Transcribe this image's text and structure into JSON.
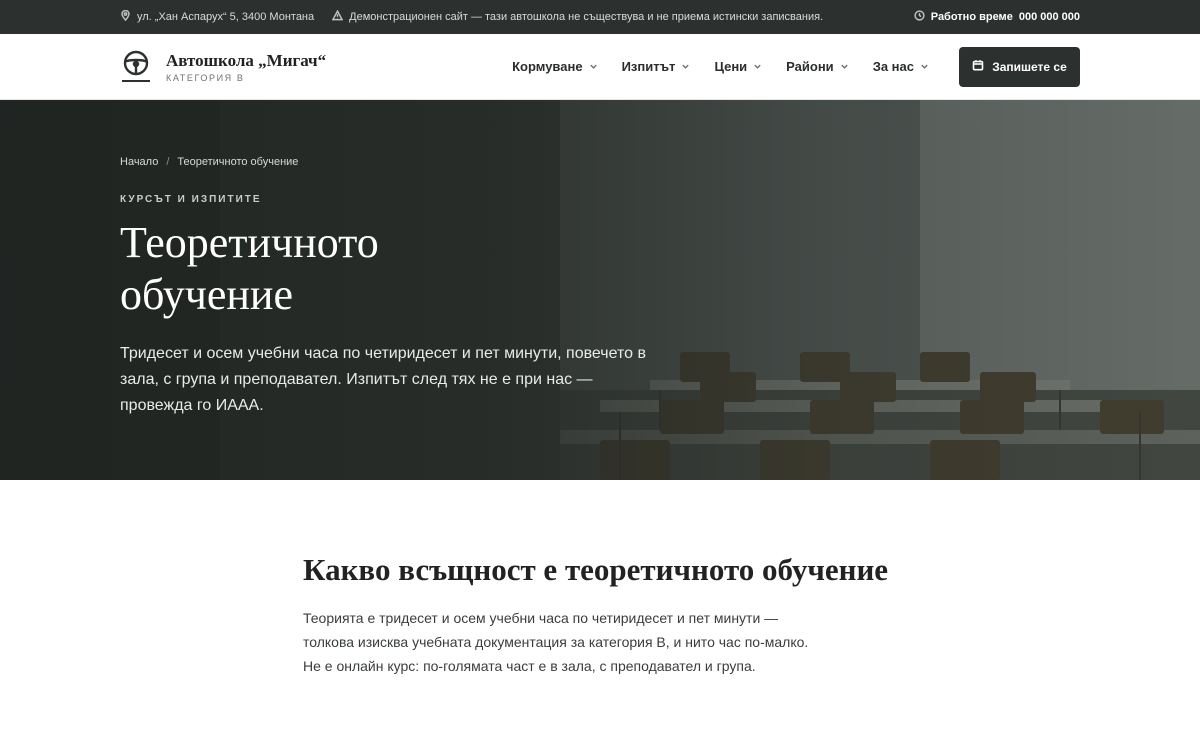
{
  "topbar": {
    "address": "ул. „Хан Аспарух“ 5, 3400 Монтана",
    "notice": "Демонстрационен сайт — тази автошкола не съществува и не приема истински записвания.",
    "hours_label": "Работно време",
    "phone": "000 000 000"
  },
  "brand": {
    "name": "Автошкола „Мигач“",
    "subtitle": "КАТЕГОРИЯ В"
  },
  "nav": {
    "items": [
      {
        "label": "Кормуване"
      },
      {
        "label": "Изпитът"
      },
      {
        "label": "Цени"
      },
      {
        "label": "Райони"
      },
      {
        "label": "За нас"
      }
    ],
    "cta_label": "Запишете се"
  },
  "hero": {
    "breadcrumb": [
      "Начало",
      "Теоретичното обучение"
    ],
    "breadcrumb_sep": "/",
    "eyebrow": "КУРСЪТ И ИЗПИТИТЕ",
    "title_line1": "Теоретичното",
    "title_line2": "обучение",
    "lead": "Тридесет и осем учебни часа по четиридесет и пет минути, повечето в зала, с група и преподавател. Изпитът след тях не е при нас — провежда го ИААА."
  },
  "section": {
    "heading": "Какво всъщност е теоретичното обучение",
    "paragraph": "Теорията е тридесет и осем учебни часа по четиридесет и пет минути — толкова изисква учебната документация за категория В, и нито час по-малко. Не е онлайн курс: по-голямата част е в зала, с преподавател и група."
  },
  "colors": {
    "dark": "#2c302e",
    "white": "#ffffff"
  }
}
